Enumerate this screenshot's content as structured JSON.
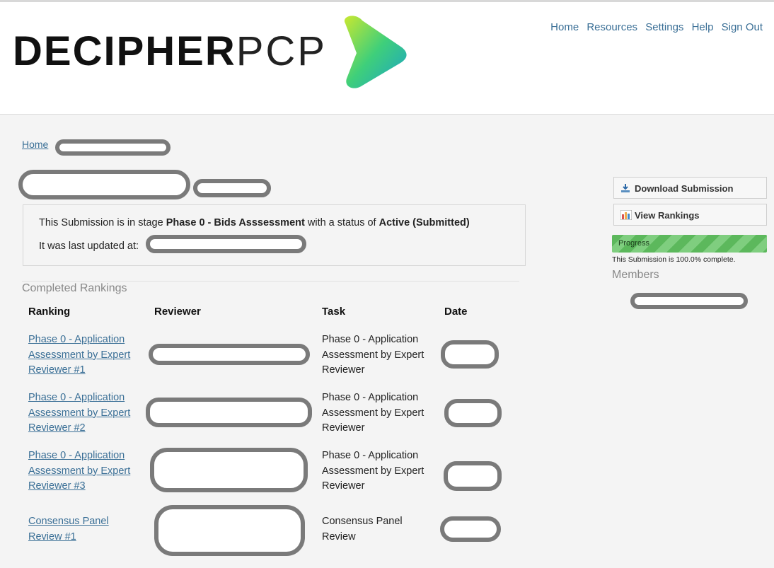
{
  "header": {
    "logo_bold": "DECIPHER",
    "logo_light": "PCP",
    "nav": [
      "Home",
      "Resources",
      "Settings",
      "Help",
      "Sign Out"
    ]
  },
  "breadcrumb": {
    "home": "Home"
  },
  "info": {
    "line1_prefix": "This Submission is in stage ",
    "stage": "Phase 0 - Bids Asssessment",
    "line1_mid": " with a status of ",
    "status": "Active (Submitted)",
    "line2": "It was last updated at:"
  },
  "rankings": {
    "title": "Completed Rankings",
    "headers": {
      "ranking": "Ranking",
      "reviewer": "Reviewer",
      "task": "Task",
      "date": "Date"
    },
    "rows": [
      {
        "ranking": "Phase 0 - Application Assessment by Expert Reviewer #1",
        "task": "Phase 0 - Application Assessment by Expert Reviewer"
      },
      {
        "ranking": "Phase 0 - Application Assessment by Expert Reviewer #2",
        "task": "Phase 0 - Application Assessment by Expert Reviewer"
      },
      {
        "ranking": "Phase 0 - Application Assessment by Expert Reviewer #3",
        "task": "Phase 0 - Application Assessment by Expert Reviewer"
      },
      {
        "ranking": "Consensus Panel Review #1",
        "task": "Consensus Panel Review"
      }
    ]
  },
  "sidebar": {
    "download": "Download Submission",
    "view": "View Rankings",
    "progress_label": "Progress",
    "progress_value": 1.0,
    "complete_text": "This Submission is 100.0% complete.",
    "members_title": "Members"
  },
  "colors": {
    "link": "#3a6f96",
    "progress": "#5cb85c",
    "redaction": "#7a7a7a"
  }
}
